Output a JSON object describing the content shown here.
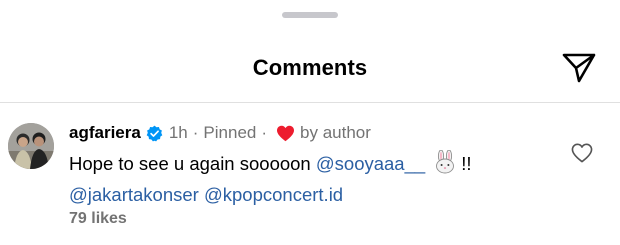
{
  "header": {
    "title": "Comments"
  },
  "icons": {
    "share": "paper-plane-icon",
    "verified": "verified-badge-icon",
    "author_like": "heart-icon",
    "like": "heart-outline-icon",
    "emoji": "rabbit-face-emoji"
  },
  "colors": {
    "verified_blue": "#0095f6",
    "heart_red": "#ed1c2e",
    "mention_blue": "#2b5fa3",
    "meta_gray": "#737373"
  },
  "comment": {
    "username": "agfariera",
    "time": "1h",
    "separator": "·",
    "pinned": "Pinned",
    "liked_by": "by author",
    "text_before": "Hope to see u again sooooon",
    "mention_1": "@sooyaaa__",
    "emoji": "🐰",
    "text_after": "!!",
    "mention_2": "@jakartakonser",
    "mention_3": "@kpopconcert.id",
    "likes": "79 likes"
  }
}
